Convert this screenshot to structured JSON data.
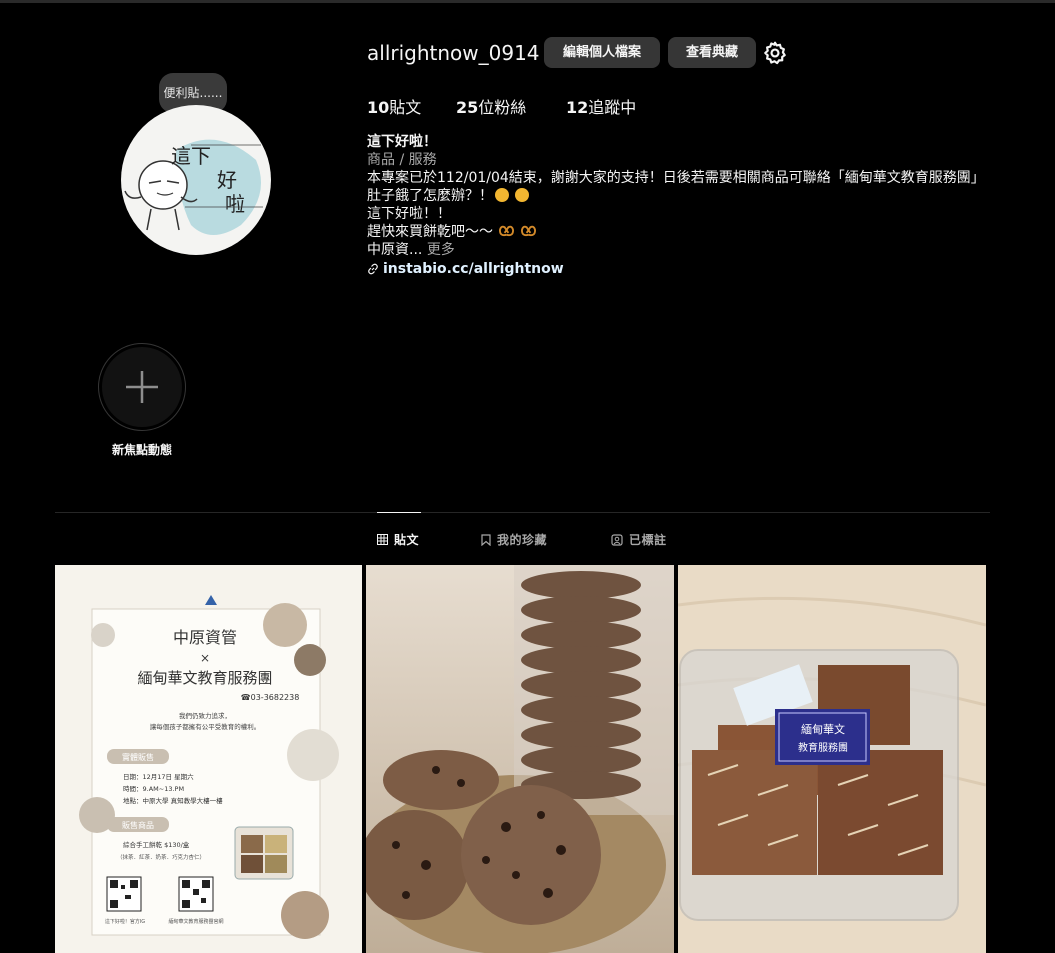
{
  "profile": {
    "username": "allrightnow_0914",
    "edit_label": "編輯個人檔案",
    "archive_label": "查看典藏",
    "note": "便利貼......",
    "avatar_text": [
      "這下",
      "好",
      "啦"
    ]
  },
  "stats": {
    "posts_count": "10",
    "posts_label": "貼文",
    "followers_count": "25",
    "followers_label": "位粉絲",
    "following_count": "12",
    "following_label": "追蹤中"
  },
  "bio": {
    "name": "這下好啦！",
    "category": "商品 / 服務",
    "line1": "本專案已於112/01/04結束，謝謝大家的支持！日後若需要相關商品可聯絡「緬甸華文教育服務團」",
    "line2": "肚子餓了怎麼辦？！",
    "line3": "這下好啦！！",
    "line4": "趕快來買餅乾吧～～",
    "line5": "中原資...",
    "more": "更多",
    "link": "instabio.cc/allrightnow"
  },
  "highlight": {
    "label": "新焦點動態"
  },
  "tabs": [
    {
      "label": "貼文"
    },
    {
      "label": "我的珍藏"
    },
    {
      "label": "已標註"
    }
  ],
  "posts": {
    "poster": {
      "title": "中原資管",
      "x": "×",
      "org": "緬甸華文教育服務團",
      "phone": "☎03-3682238",
      "slogan1": "我們仍致力追求，",
      "slogan2": "讓每個孩子都擁有公平受教育的權利。",
      "section1": "實體販售",
      "date": "日期：12月17日 星期六",
      "time": "時間：9.AM~13.PM",
      "place": "地點：中原大學 真知教學大樓一樓",
      "section2": "販售商品",
      "product": "綜合手工餅乾 $130/盒",
      "flavors": "（抹茶．紅茶．奶茶．巧克力杏仁）",
      "qr1": "這下好啦！官方IG",
      "qr2": "緬甸華文教育服務團官網"
    },
    "box_label": [
      "緬甸華文",
      "教育服務團"
    ]
  },
  "colors": {
    "background": "#000000",
    "button": "#363636",
    "muted": "#a8a8a8",
    "link": "#e0f1ff"
  }
}
